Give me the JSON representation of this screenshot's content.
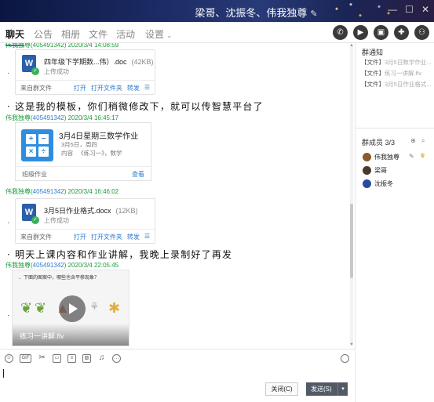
{
  "window": {
    "title": "梁哥、沈振冬、伟我独尊",
    "controls": [
      "—",
      "☐",
      "✕"
    ]
  },
  "tabs": [
    {
      "label": "聊天",
      "active": true
    },
    {
      "label": "公告"
    },
    {
      "label": "相册"
    },
    {
      "label": "文件"
    },
    {
      "label": "活动"
    },
    {
      "label": "设置"
    }
  ],
  "toolbar_icons": [
    "phone-icon",
    "video-call-icon",
    "screen-share-icon",
    "message-plus-icon",
    "add-member-icon"
  ],
  "chat": {
    "top_partial_sender": "伟我独尊(405491342) 2020/3/4 14:08:59",
    "file1": {
      "name": "四年级下学期数...伟）.doc",
      "size": "(42KB)",
      "status": "上传成功",
      "source": "来自群文件",
      "actions": [
        "打开",
        "打开文件夹",
        "转发"
      ]
    },
    "msg1": "这是我的模板，你们稍微修改下，就可以传智慧平台了",
    "sender2": {
      "name": "伟我独尊",
      "qq": "405491342",
      "time": "2020/3/4 16:45:17"
    },
    "homework": {
      "title": "3月4日星期三数学作业",
      "date": "3月5日，周四",
      "content_label": "内容",
      "content": "《练习一》，数学",
      "type": "班级作业",
      "action": "查看"
    },
    "sender3": {
      "name": "伟我独尊",
      "qq": "405491342",
      "time": "2020/3/4 16:46:02"
    },
    "file2": {
      "name": "3月5日作业格式.docx",
      "size": "(12KB)",
      "status": "上传成功",
      "source": "来自群文件",
      "actions": [
        "打开",
        "打开文件夹",
        "转发"
      ]
    },
    "msg2": "明天上课内容和作业讲解，我晚上录制好了再发",
    "sender4": {
      "name": "伟我独尊",
      "qq": "405491342",
      "time": "2020/3/4 22:05:45"
    },
    "video": {
      "caption": "、下面的图案中，哪些也含平移现象？",
      "name": "练习一讲解.flv"
    }
  },
  "notice_panel": {
    "title": "群通知",
    "items": [
      {
        "tag": "【文件】",
        "text": "3月5日数学作业..."
      },
      {
        "tag": "【文件】",
        "text": "练习一讲解.flv"
      },
      {
        "tag": "【文件】",
        "text": "3月5日作业格式..."
      }
    ]
  },
  "members_panel": {
    "title": "群成员 3/3",
    "members": [
      {
        "name": "伟我独尊",
        "color": "#8b5a2b"
      },
      {
        "name": "梁哥",
        "color": "#4a3a2a"
      },
      {
        "name": "沈振冬",
        "color": "#2a4aa0"
      }
    ]
  },
  "input": {
    "close_label": "关闭(C)",
    "send_label": "发送(S)",
    "tools": [
      "emoji-icon",
      "gif-icon",
      "scissors-icon",
      "folder-icon",
      "document-icon",
      "image-icon",
      "bell-icon",
      "more-icon"
    ]
  },
  "colors": {
    "accent": "#2d7dd2",
    "sender_green": "#1e9a3c",
    "link_blue": "#2f7ad0",
    "send_button": "#525a66"
  }
}
